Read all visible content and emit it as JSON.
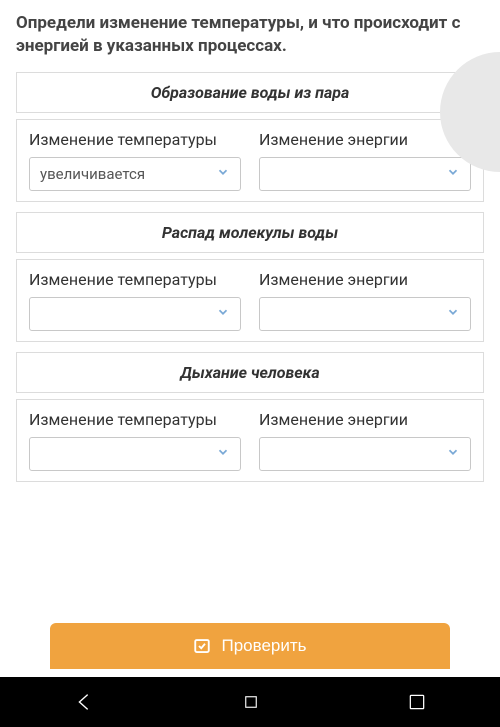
{
  "question": "Определи изменение температуры, и что происходит с энергией в указанных процессах.",
  "sections": [
    {
      "title": "Образование воды из пара",
      "temp_label": "Изменение температуры",
      "energy_label": "Изменение энергии",
      "temp_value": "увеличивается",
      "energy_value": ""
    },
    {
      "title": "Распад молекулы воды",
      "temp_label": "Изменение температуры",
      "energy_label": "Изменение энергии",
      "temp_value": "",
      "energy_value": ""
    },
    {
      "title": "Дыхание человека",
      "temp_label": "Изменение температуры",
      "energy_label": "Изменение энергии",
      "temp_value": "",
      "energy_value": ""
    }
  ],
  "check_button": "Проверить"
}
